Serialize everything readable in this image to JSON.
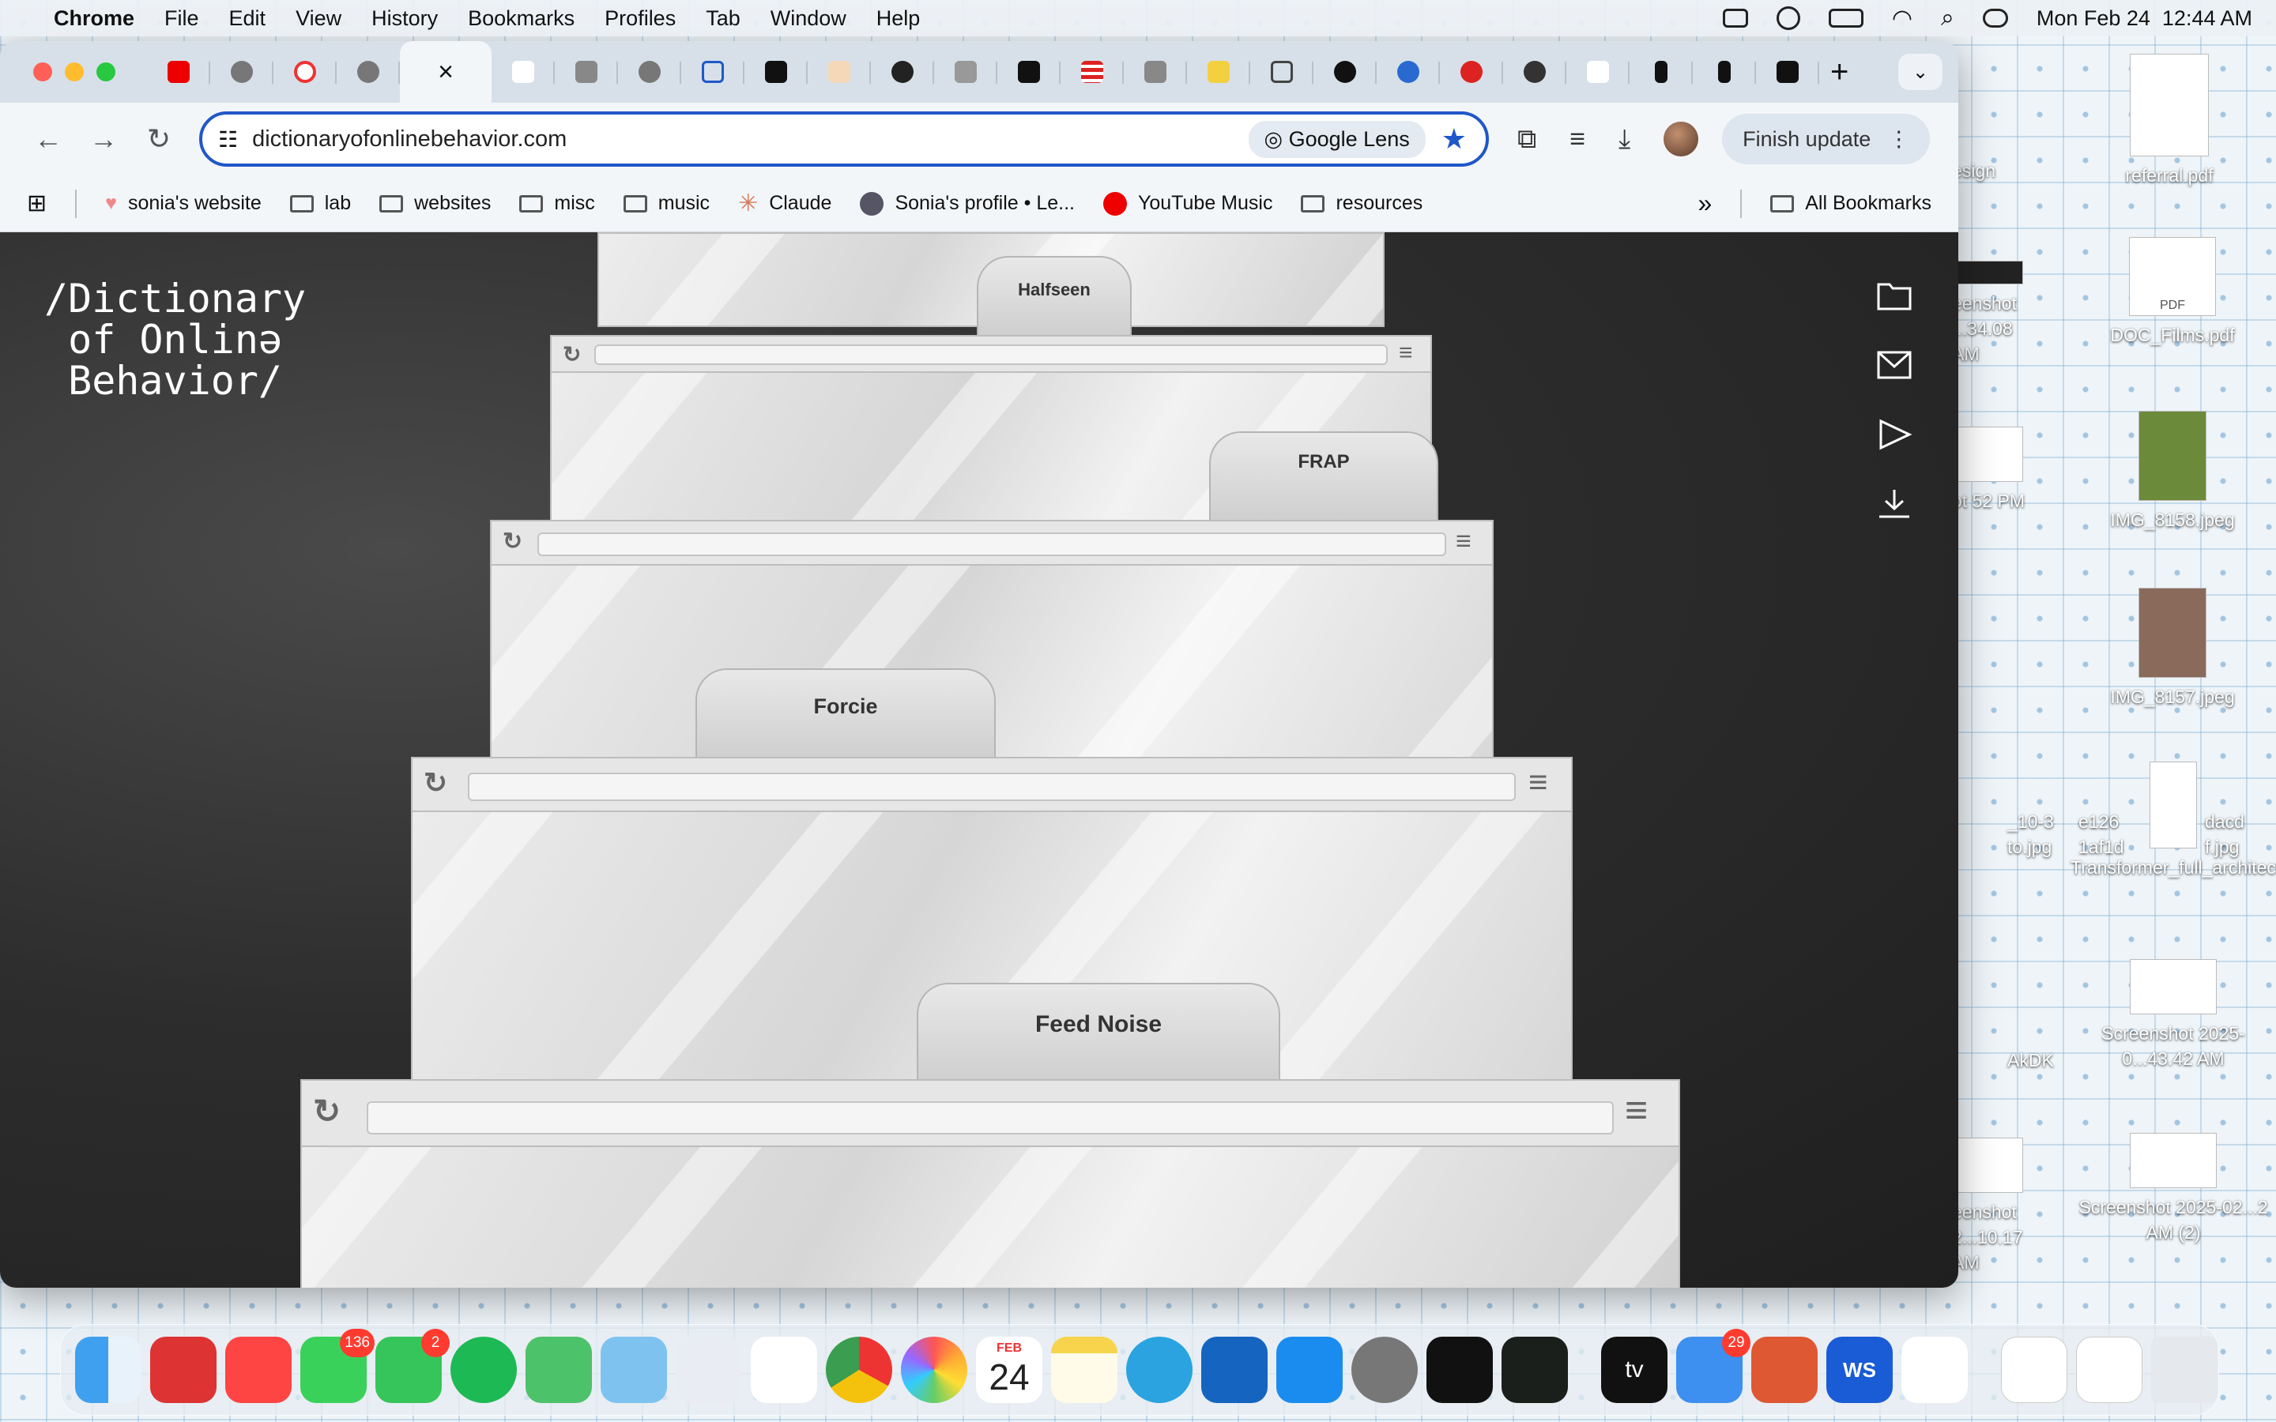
{
  "menubar": {
    "app_name": "Chrome",
    "items": [
      "File",
      "Edit",
      "View",
      "History",
      "Bookmarks",
      "Profiles",
      "Tab",
      "Window",
      "Help"
    ],
    "datetime": "Mon Feb 24  12:44 AM"
  },
  "desktop": {
    "files": [
      {
        "name": "referral.pdf"
      },
      {
        "name": "DOC_Films.pdf",
        "thumb_text": "PDF"
      },
      {
        "name": "IMG_8158.jpeg"
      },
      {
        "name": "IMG_8157.jpeg"
      },
      {
        "name": "Transformer_full_architecture.png"
      },
      {
        "name": "Screenshot 2025-0...43.42 AM"
      },
      {
        "name": "Screenshot 2025-02...2 AM (2)"
      }
    ],
    "partial_labels": [
      "esign",
      "eenshot ...34.08 AM",
      "ot 52 PM",
      "_10-3 to.jpg",
      "e126 1af1d",
      "dacd f.jpg",
      "AkDK",
      "eenshot 2...10.17 AM"
    ]
  },
  "browser": {
    "tabs_count": 26,
    "active_tab_close": "×",
    "new_tab": "+",
    "url": "dictionaryofonlinebehavior.com",
    "lens_label": "Google Lens",
    "finish_update_label": "Finish update",
    "bookmarks": [
      {
        "label": "sonia's website",
        "icon": "heart-icon"
      },
      {
        "label": "lab",
        "icon": "folder-icon"
      },
      {
        "label": "websites",
        "icon": "folder-icon"
      },
      {
        "label": "misc",
        "icon": "folder-icon"
      },
      {
        "label": "music",
        "icon": "folder-icon"
      },
      {
        "label": "Claude",
        "icon": "claude-icon"
      },
      {
        "label": "Sonia's profile • Le...",
        "icon": "profile-icon"
      },
      {
        "label": "YouTube Music",
        "icon": "youtube-music-icon"
      },
      {
        "label": "resources",
        "icon": "folder-icon"
      }
    ],
    "overflow": "»",
    "all_bookmarks": "All Bookmarks"
  },
  "page": {
    "site_title": "/Dictionary\n of Onlinə\n Behavior/",
    "stack_windows": [
      "Halfseen",
      "FRAP",
      "Forcie",
      "Feed Noise"
    ],
    "side_icons": [
      "folder-icon",
      "mail-icon",
      "play-icon",
      "download-icon"
    ]
  },
  "dock": {
    "messages_badge": "136",
    "facetime_badge": "2",
    "mail_badge": "29",
    "calendar_month": "FEB",
    "calendar_day": "24",
    "tv_label": "tv",
    "ws_label": "WS"
  },
  "colors": {
    "accent": "#2057c9",
    "page_bg": "#2d2d2d"
  }
}
